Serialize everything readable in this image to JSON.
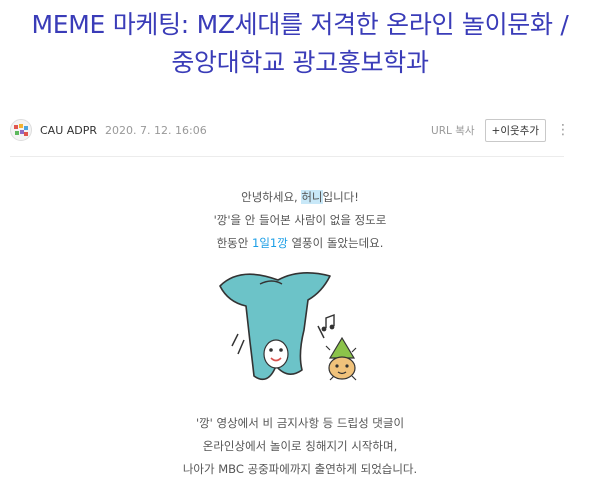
{
  "title": {
    "line1": "MEME 마케팅: MZ세대를 저격한 온라인 놀이문화 /",
    "line2": "중앙대학교 광고홍보학과"
  },
  "meta": {
    "author": "CAU ADPR",
    "date": "2020. 7. 12. 16:06",
    "url_copy": "URL 복사",
    "add_neighbor": "+이웃추가",
    "more": "⋮"
  },
  "body": {
    "p1_a_pre": "안녕하세요, ",
    "p1_a_hl": "허니",
    "p1_a_post": "입니다!",
    "p1_b": "'깡'을 안 들어본 사람이 없을 정도로",
    "p1_c_pre": "한동안 ",
    "p1_c_blue": "1일1깡",
    "p1_c_post": " 열풍이 돌았는데요.",
    "p2_a": "'깡' 영상에서 비 금지사항 등 드립성 댓글이",
    "p2_b": "온라인상에서 놀이로 칭해지기 시작하며,",
    "p2_c": "나아가 MBC 공중파에까지 출연하게 되었습니다."
  },
  "colors": {
    "title": "#3a3cb8",
    "highlight": "#c8e8f8",
    "accent_blue": "#1a9ee6",
    "character": "#6cc3c8"
  }
}
